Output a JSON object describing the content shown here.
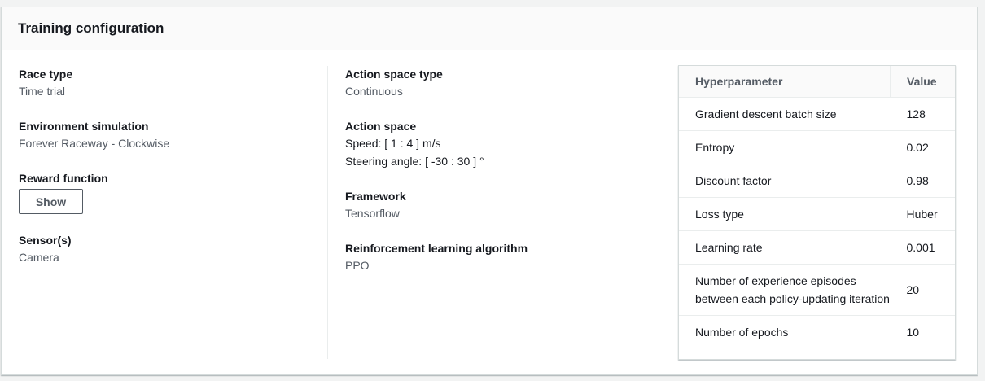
{
  "panel": {
    "title": "Training configuration"
  },
  "left": {
    "race_type": {
      "label": "Race type",
      "value": "Time trial"
    },
    "environment": {
      "label": "Environment simulation",
      "value": "Forever Raceway - Clockwise"
    },
    "reward": {
      "label": "Reward function",
      "button": "Show"
    },
    "sensors": {
      "label": "Sensor(s)",
      "value": "Camera"
    }
  },
  "middle": {
    "action_space_type": {
      "label": "Action space type",
      "value": "Continuous"
    },
    "action_space": {
      "label": "Action space",
      "speed": "Speed: [ 1 : 4 ] m/s",
      "steering": "Steering angle: [ -30 : 30 ] °"
    },
    "framework": {
      "label": "Framework",
      "value": "Tensorflow"
    },
    "algorithm": {
      "label": "Reinforcement learning algorithm",
      "value": "PPO"
    }
  },
  "table": {
    "headers": [
      "Hyperparameter",
      "Value"
    ],
    "rows": [
      {
        "name": "Gradient descent batch size",
        "value": "128"
      },
      {
        "name": "Entropy",
        "value": "0.02"
      },
      {
        "name": "Discount factor",
        "value": "0.98"
      },
      {
        "name": "Loss type",
        "value": "Huber"
      },
      {
        "name": "Learning rate",
        "value": "0.001"
      },
      {
        "name": "Number of experience episodes between each policy-updating iteration",
        "value": "20"
      },
      {
        "name": "Number of epochs",
        "value": "10"
      }
    ]
  }
}
